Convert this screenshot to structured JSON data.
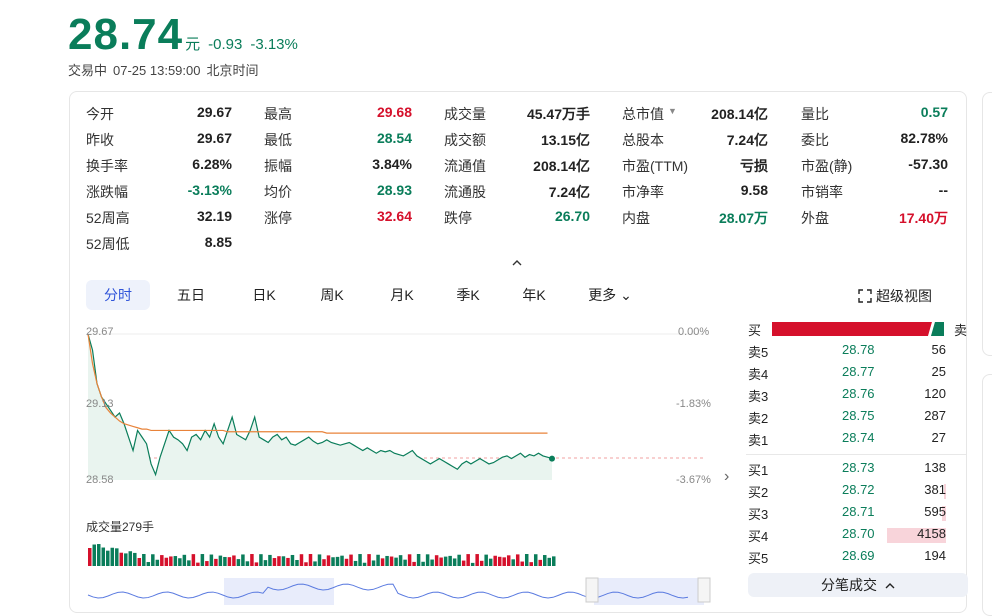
{
  "quote": {
    "price": "28.74",
    "unit": "元",
    "change": "-0.93",
    "change_pct": "-3.13%",
    "status": "交易中",
    "datetime": "07-25 13:59:00",
    "timezone": "北京时间"
  },
  "stats": [
    [
      {
        "label": "今开",
        "value": "29.67",
        "color": "#222"
      },
      {
        "label": "最高",
        "value": "29.68",
        "color": "#d5102b"
      },
      {
        "label": "成交量",
        "value": "45.47万手",
        "color": "#222"
      },
      {
        "label": "总市值",
        "value": "208.14亿",
        "color": "#222"
      },
      {
        "label": "量比",
        "value": "0.57",
        "color": "#0a7d5a"
      }
    ],
    [
      {
        "label": "昨收",
        "value": "29.67",
        "color": "#222"
      },
      {
        "label": "最低",
        "value": "28.54",
        "color": "#0a7d5a"
      },
      {
        "label": "成交额",
        "value": "13.15亿",
        "color": "#222"
      },
      {
        "label": "总股本",
        "value": "7.24亿",
        "color": "#222"
      },
      {
        "label": "委比",
        "value": "82.78%",
        "color": "#222"
      }
    ],
    [
      {
        "label": "换手率",
        "value": "6.28%",
        "color": "#222"
      },
      {
        "label": "振幅",
        "value": "3.84%",
        "color": "#222"
      },
      {
        "label": "流通值",
        "value": "208.14亿",
        "color": "#222"
      },
      {
        "label": "市盈(TTM)",
        "value": "亏损",
        "color": "#222"
      },
      {
        "label": "市盈(静)",
        "value": "-57.30",
        "color": "#222"
      }
    ],
    [
      {
        "label": "涨跌幅",
        "value": "-3.13%",
        "color": "#0a7d5a"
      },
      {
        "label": "均价",
        "value": "28.93",
        "color": "#0a7d5a"
      },
      {
        "label": "流通股",
        "value": "7.24亿",
        "color": "#222"
      },
      {
        "label": "市净率",
        "value": "9.58",
        "color": "#222"
      },
      {
        "label": "市销率",
        "value": "--",
        "color": "#222"
      }
    ],
    [
      {
        "label": "52周高",
        "value": "32.19",
        "color": "#222"
      },
      {
        "label": "涨停",
        "value": "32.64",
        "color": "#d5102b"
      },
      {
        "label": "跌停",
        "value": "26.70",
        "color": "#0a7d5a"
      },
      {
        "label": "内盘",
        "value": "28.07万",
        "color": "#0a7d5a"
      },
      {
        "label": "外盘",
        "value": "17.40万",
        "color": "#d5102b"
      }
    ],
    [
      {
        "label": "52周低",
        "value": "8.85",
        "color": "#222"
      }
    ]
  ],
  "tabs": [
    "分时",
    "五日",
    "日K",
    "周K",
    "月K",
    "季K",
    "年K",
    "更多"
  ],
  "super_view": "超级视图",
  "chart": {
    "y_top": "29.67",
    "y_mid": "29.13",
    "y_bottom": "28.58",
    "pct_top": "0.00%",
    "pct_mid": "-1.83%",
    "pct_bottom": "-3.67%",
    "volume_title": "成交量279手"
  },
  "chart_data": {
    "type": "line",
    "ylim": [
      28.58,
      29.67
    ],
    "series": [
      {
        "values": [
          29.67,
          29.55,
          29.3,
          29.2,
          29.15,
          29.1,
          29.05,
          29.08,
          29.0,
          28.9,
          28.8,
          28.95,
          28.9,
          28.85,
          28.7,
          28.62,
          28.75,
          28.85,
          28.95,
          28.9,
          28.88,
          28.85,
          28.8,
          28.9,
          28.92,
          28.88,
          28.95,
          28.9,
          29.0,
          28.9,
          28.85,
          28.95,
          29.05,
          28.92,
          28.9,
          28.88,
          28.95,
          29.05,
          28.9,
          28.88,
          28.86,
          28.9,
          28.92,
          28.88,
          28.9,
          28.85,
          28.84,
          28.86,
          28.88,
          28.9,
          28.87,
          28.85,
          28.86,
          28.88,
          28.86,
          28.85,
          28.84,
          28.85,
          28.86,
          28.84,
          28.82,
          28.8,
          28.82,
          28.8,
          28.78,
          28.8,
          28.79,
          28.8,
          28.78,
          28.77,
          28.76,
          28.78,
          28.8,
          28.76,
          28.74,
          28.72,
          28.7,
          28.72,
          28.74,
          28.72,
          28.7,
          28.68,
          28.66,
          28.7,
          28.72,
          28.7,
          28.72,
          28.74,
          28.72,
          28.7,
          28.71,
          28.73,
          28.75,
          28.76,
          28.74,
          28.76,
          28.78,
          28.75,
          28.77,
          28.76,
          28.78,
          28.76,
          28.75,
          28.74
        ]
      },
      {
        "values": [
          29.67,
          29.45,
          29.3,
          29.2,
          29.12,
          29.08,
          29.05,
          29.02,
          29.0,
          28.99,
          28.98,
          28.97,
          28.96,
          28.96,
          28.95,
          28.95,
          28.95,
          28.95,
          28.95,
          28.95,
          28.95,
          28.95,
          28.95,
          28.95,
          28.95,
          28.95,
          28.95,
          28.95,
          28.95,
          28.95,
          28.95,
          28.94,
          28.94,
          28.94,
          28.94,
          28.94,
          28.94,
          28.94,
          28.94,
          28.94,
          28.94,
          28.94,
          28.94,
          28.94,
          28.94,
          28.94,
          28.94,
          28.94,
          28.94,
          28.94,
          28.94,
          28.94,
          28.94,
          28.93,
          28.93,
          28.93,
          28.93,
          28.93,
          28.93,
          28.93,
          28.93,
          28.93,
          28.93,
          28.93,
          28.93,
          28.93,
          28.93,
          28.93,
          28.93,
          28.93,
          28.93,
          28.93,
          28.93,
          28.93,
          28.93,
          28.93,
          28.93,
          28.93,
          28.93,
          28.93,
          28.93,
          28.93,
          28.93,
          28.93,
          28.93,
          28.93,
          28.93,
          28.93,
          28.93,
          28.93,
          28.93,
          28.93,
          28.93,
          28.93,
          28.93,
          28.93,
          28.93,
          28.93,
          28.93,
          28.93,
          28.93,
          28.93,
          28.93
        ]
      }
    ]
  },
  "orderbook": {
    "buy_label": "买",
    "sell_label": "卖",
    "buy_ratio": 0.93,
    "asks": [
      {
        "name": "卖5",
        "price": "28.78",
        "qty": "56",
        "bar": 0.0
      },
      {
        "name": "卖4",
        "price": "28.77",
        "qty": "25",
        "bar": 0.0
      },
      {
        "name": "卖3",
        "price": "28.76",
        "qty": "120",
        "bar": 0.0
      },
      {
        "name": "卖2",
        "price": "28.75",
        "qty": "287",
        "bar": 0.0
      },
      {
        "name": "卖1",
        "price": "28.74",
        "qty": "27",
        "bar": 0.0
      }
    ],
    "bids": [
      {
        "name": "买1",
        "price": "28.73",
        "qty": "138",
        "bar": 0.0
      },
      {
        "name": "买2",
        "price": "28.72",
        "qty": "381",
        "bar": 0.02
      },
      {
        "name": "买3",
        "price": "28.71",
        "qty": "595",
        "bar": 0.03
      },
      {
        "name": "买4",
        "price": "28.70",
        "qty": "4158",
        "bar": 0.49
      },
      {
        "name": "买5",
        "price": "28.69",
        "qty": "194",
        "bar": 0.0
      }
    ],
    "trade_detail": "分笔成交"
  },
  "colors": {
    "up": "#d5102b",
    "down": "#0a7d5a",
    "accent": "#2f54d9",
    "avg_line": "#e8833a"
  }
}
